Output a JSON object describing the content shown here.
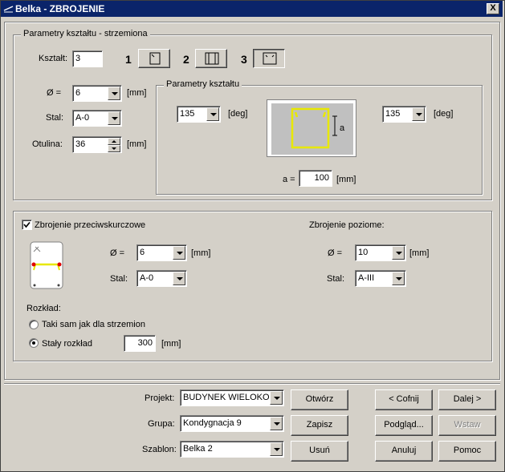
{
  "window": {
    "title": "Belka - ZBROJENIE",
    "close_label": "X"
  },
  "stirrups": {
    "group_title": "Parametry kształtu - strzemiona",
    "shape_label": "Kształt:",
    "shape_value": "3",
    "shape_options": [
      {
        "number": "1",
        "icon": "stirrup-shape-1-icon"
      },
      {
        "number": "2",
        "icon": "stirrup-shape-2-icon"
      },
      {
        "number": "3",
        "icon": "stirrup-shape-3-icon",
        "selected": true
      }
    ],
    "diameter_label": "Ø =",
    "diameter_value": "6",
    "diameter_unit": "[mm]",
    "steel_label": "Stal:",
    "steel_value": "A-0",
    "cover_label": "Otulina:",
    "cover_value": "36",
    "cover_unit": "[mm]"
  },
  "shape_params": {
    "group_title": "Parametry kształtu",
    "left_angle": "135",
    "left_angle_unit": "[deg]",
    "right_angle": "135",
    "right_angle_unit": "[deg]",
    "dim_label": "a",
    "a_label": "a =",
    "a_value": "100",
    "a_unit": "[mm]",
    "colors": {
      "stirrup": "#e8e800",
      "preview_bg": "#c0c0c0"
    }
  },
  "shear": {
    "enabled_label": "Zbrojenie przeciwskurczowe",
    "enabled": true,
    "diameter_label": "Ø =",
    "diameter_value": "6",
    "diameter_unit": "[mm]",
    "steel_label": "Stal:",
    "steel_value": "A-0",
    "distribution_label": "Rozkład:",
    "option_same_label": "Taki sam jak dla strzemion",
    "option_const_label": "Stały rozkład",
    "selected_option": "const",
    "const_value": "300",
    "const_unit": "[mm]",
    "horizontal_title": "Zbrojenie poziome:",
    "h_diameter_label": "Ø =",
    "h_diameter_value": "10",
    "h_diameter_unit": "[mm]",
    "h_steel_label": "Stal:",
    "h_steel_value": "A-III",
    "colors": {
      "bar": "#e8e800",
      "bar_point": "#e00000"
    }
  },
  "bottom": {
    "project_label": "Projekt:",
    "project_value": "BUDYNEK WIELOKOND",
    "group_label": "Grupa:",
    "group_value": "Kondygnacja 9",
    "template_label": "Szablon:",
    "template_value": "Belka 2"
  },
  "buttons": {
    "open": "Otwórz",
    "save": "Zapisz",
    "delete": "Usuń",
    "back": "< Cofnij",
    "next": "Dalej >",
    "preview": "Podgląd...",
    "insert": "Wstaw",
    "cancel": "Anuluj",
    "help": "Pomoc"
  }
}
